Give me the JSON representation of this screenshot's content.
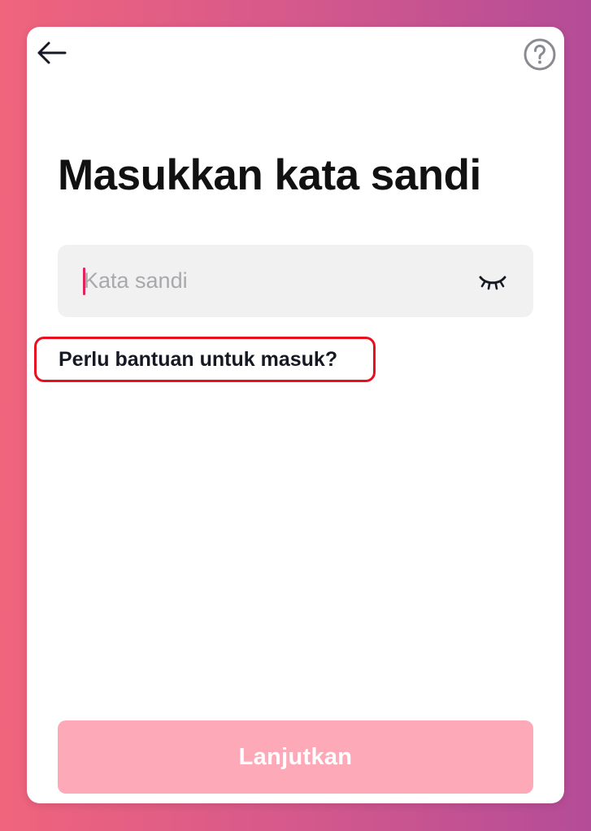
{
  "header": {
    "back_icon": "arrow-left-icon",
    "help_icon": "question-circle-icon"
  },
  "title": "Masukkan kata sandi",
  "password": {
    "placeholder": "Kata sandi",
    "value": "",
    "toggle_icon": "eye-closed-icon"
  },
  "help_link": "Perlu bantuan untuk masuk?",
  "submit": {
    "label": "Lanjutkan",
    "enabled": false
  },
  "colors": {
    "background_gradient": [
      "#f0647c",
      "#b44c98"
    ],
    "caret": "#e0245e",
    "highlight_border": "#e8101e",
    "button_disabled": "#fea9b8",
    "input_background": "#f1f1f2"
  }
}
